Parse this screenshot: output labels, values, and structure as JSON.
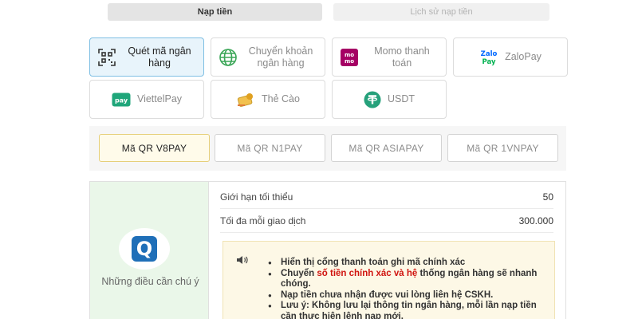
{
  "tabs": {
    "deposit": "Nạp tiền",
    "history": "Lịch sử nạp tiền"
  },
  "methods": [
    {
      "label": "Quét mã ngân hàng",
      "icon": "qr-scan-icon",
      "selected": true
    },
    {
      "label": "Chuyển khoản ngân hàng",
      "icon": "globe-icon",
      "selected": false
    },
    {
      "label": "Momo thanh toán",
      "icon": "momo-icon",
      "selected": false
    },
    {
      "label": "ZaloPay",
      "icon": "zalopay-icon",
      "selected": false
    },
    {
      "label": "ViettelPay",
      "icon": "viettelpay-icon",
      "selected": false
    },
    {
      "label": "Thẻ Cào",
      "icon": "scratch-card-icon",
      "selected": false
    },
    {
      "label": "USDT",
      "icon": "tether-icon",
      "selected": false
    }
  ],
  "providers": [
    {
      "label": "Mã QR V8PAY",
      "selected": true
    },
    {
      "label": "Mã QR N1PAY",
      "selected": false
    },
    {
      "label": "Mã QR ASIAPAY",
      "selected": false
    },
    {
      "label": "Mã QR 1VNPAY",
      "selected": false
    }
  ],
  "notes": {
    "title": "Những điều cần chú ý",
    "icon": "q-logo-icon"
  },
  "limits": {
    "min_label": "Giới hạn tối thiểu",
    "min_value": "50",
    "max_label": "Tối đa mỗi giao dịch",
    "max_value": "300.000"
  },
  "notice": {
    "items": [
      {
        "text": "Hiển thị cổng thanh toán ghi mã chính xác"
      },
      {
        "prefix": "Chuyển ",
        "highlight": "số tiền chính xác và hệ",
        "suffix": " thống ngân hàng sẽ nhanh chóng."
      },
      {
        "text": "Nạp tiền chưa nhận được vui lòng liên hệ CSKH."
      },
      {
        "text": "Lưu ý: Không lưu lại thông tin ngân hàng, mỗi lần nạp tiền cần thực hiện lệnh nạp mới."
      }
    ]
  },
  "colors": {
    "selected_method_bg": "#e8f4fb",
    "selected_provider_bg": "#fffbea",
    "notes_panel_bg": "#eaf7e9",
    "notice_bg": "#fdf8e6",
    "highlight_red": "#d0140f",
    "q_logo_blue": "#1f6fb8"
  }
}
